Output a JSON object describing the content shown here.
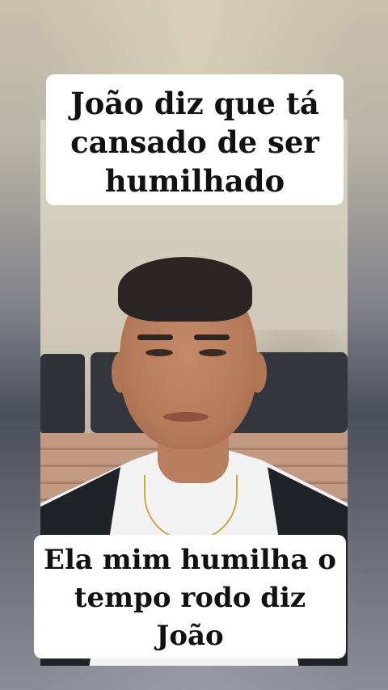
{
  "caption_top": {
    "lines": [
      "João diz que tá",
      "cansado de ser",
      "humilhado"
    ]
  },
  "caption_bottom": {
    "lines": [
      "Ela mim humilha o",
      "tempo rodo diz",
      "João"
    ]
  }
}
